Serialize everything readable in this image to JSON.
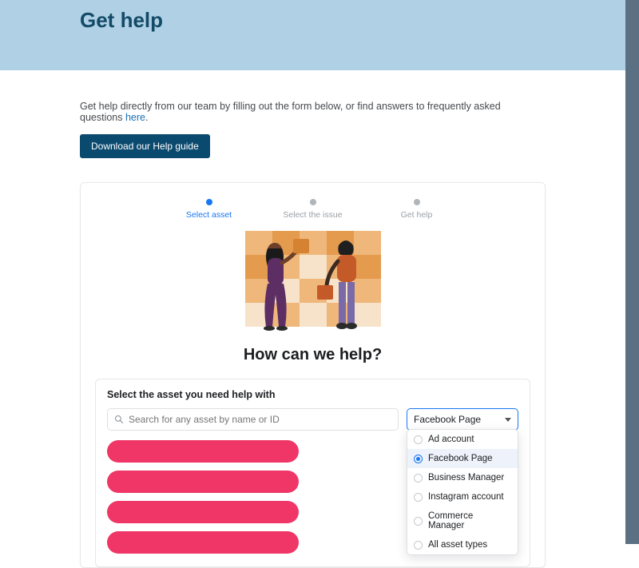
{
  "banner": {
    "title": "Get help"
  },
  "intro": {
    "text_before_link": "Get help directly from our team by filling out the form below, or find answers to frequently asked questions ",
    "link_text": "here",
    "text_after_link": "."
  },
  "download_button": {
    "label": "Download our Help guide"
  },
  "stepper": {
    "steps": [
      {
        "label": "Select asset",
        "active": true
      },
      {
        "label": "Select the issue",
        "active": false
      },
      {
        "label": "Get help",
        "active": false
      }
    ]
  },
  "headline": "How can we help?",
  "panel": {
    "title": "Select the asset you need help with",
    "search_placeholder": "Search for any asset by name or ID",
    "type_select": {
      "selected": "Facebook Page"
    },
    "dropdown_options": [
      {
        "label": "Ad account",
        "selected": false
      },
      {
        "label": "Facebook Page",
        "selected": true
      },
      {
        "label": "Business Manager",
        "selected": false
      },
      {
        "label": "Instagram account",
        "selected": false
      },
      {
        "label": "Commerce Manager",
        "selected": false
      },
      {
        "label": "All asset types",
        "selected": false
      }
    ],
    "asset_placeholders": [
      1,
      2,
      3,
      4
    ]
  }
}
